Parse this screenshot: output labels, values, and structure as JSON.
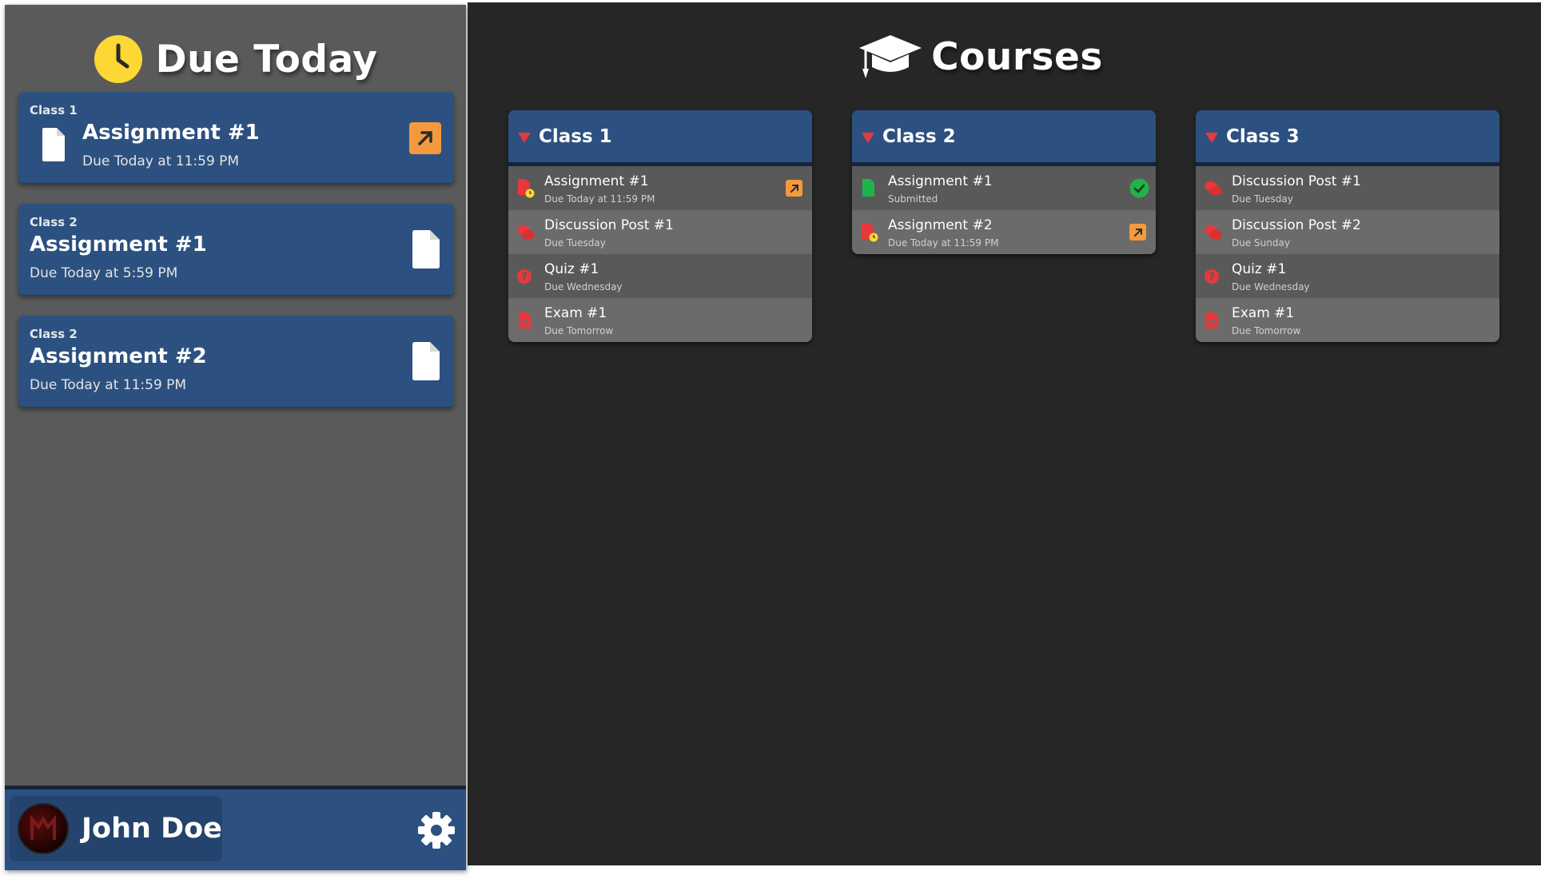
{
  "sidebar": {
    "title": "Due Today",
    "cards": [
      {
        "class_name": "Class 1",
        "title": "Assignment #1",
        "due": "Due Today at 11:59 PM",
        "action": "open-external"
      },
      {
        "class_name": "Class 2",
        "title": "Assignment #1",
        "due": "Due Today at 5:59 PM",
        "action": "file"
      },
      {
        "class_name": "Class 2",
        "title": "Assignment #2",
        "due": "Due Today at 11:59 PM",
        "action": "file"
      }
    ],
    "footer": {
      "user_name": "John Doe"
    }
  },
  "main": {
    "title": "Courses",
    "courses": [
      {
        "name": "Class 1",
        "items": [
          {
            "title": "Assignment #1",
            "due": "Due Today at 11:59 PM",
            "icon": "file-late-icon",
            "action": "open-external"
          },
          {
            "title": "Discussion Post #1",
            "due": "Due Tuesday",
            "icon": "discussion-icon"
          },
          {
            "title": "Quiz #1",
            "due": "Due Wednesday",
            "icon": "quiz-icon"
          },
          {
            "title": "Exam #1",
            "due": "Due Tomorrow",
            "icon": "exam-icon"
          }
        ]
      },
      {
        "name": "Class 2",
        "items": [
          {
            "title": "Assignment #1",
            "due": "Submitted",
            "icon": "file-submitted-icon",
            "action": "submitted-check"
          },
          {
            "title": "Assignment #2",
            "due": "Due Today at 11:59 PM",
            "icon": "file-late-icon",
            "action": "open-external"
          }
        ]
      },
      {
        "name": "Class 3",
        "items": [
          {
            "title": "Discussion Post #1",
            "due": "Due Tuesday",
            "icon": "discussion-icon"
          },
          {
            "title": "Discussion Post #2",
            "due": "Due Sunday",
            "icon": "discussion-icon"
          },
          {
            "title": "Quiz #1",
            "due": "Due Wednesday",
            "icon": "quiz-icon"
          },
          {
            "title": "Exam #1",
            "due": "Due Tomorrow",
            "icon": "exam-icon"
          }
        ]
      }
    ]
  },
  "colors": {
    "sidebar_bg": "#5a5a5a",
    "main_bg": "#262626",
    "card_blue": "#2c5180",
    "accent_orange": "#f39a3e",
    "alert_red": "#e8383b",
    "success_green": "#21b24c",
    "clock_yellow": "#fdd835"
  }
}
